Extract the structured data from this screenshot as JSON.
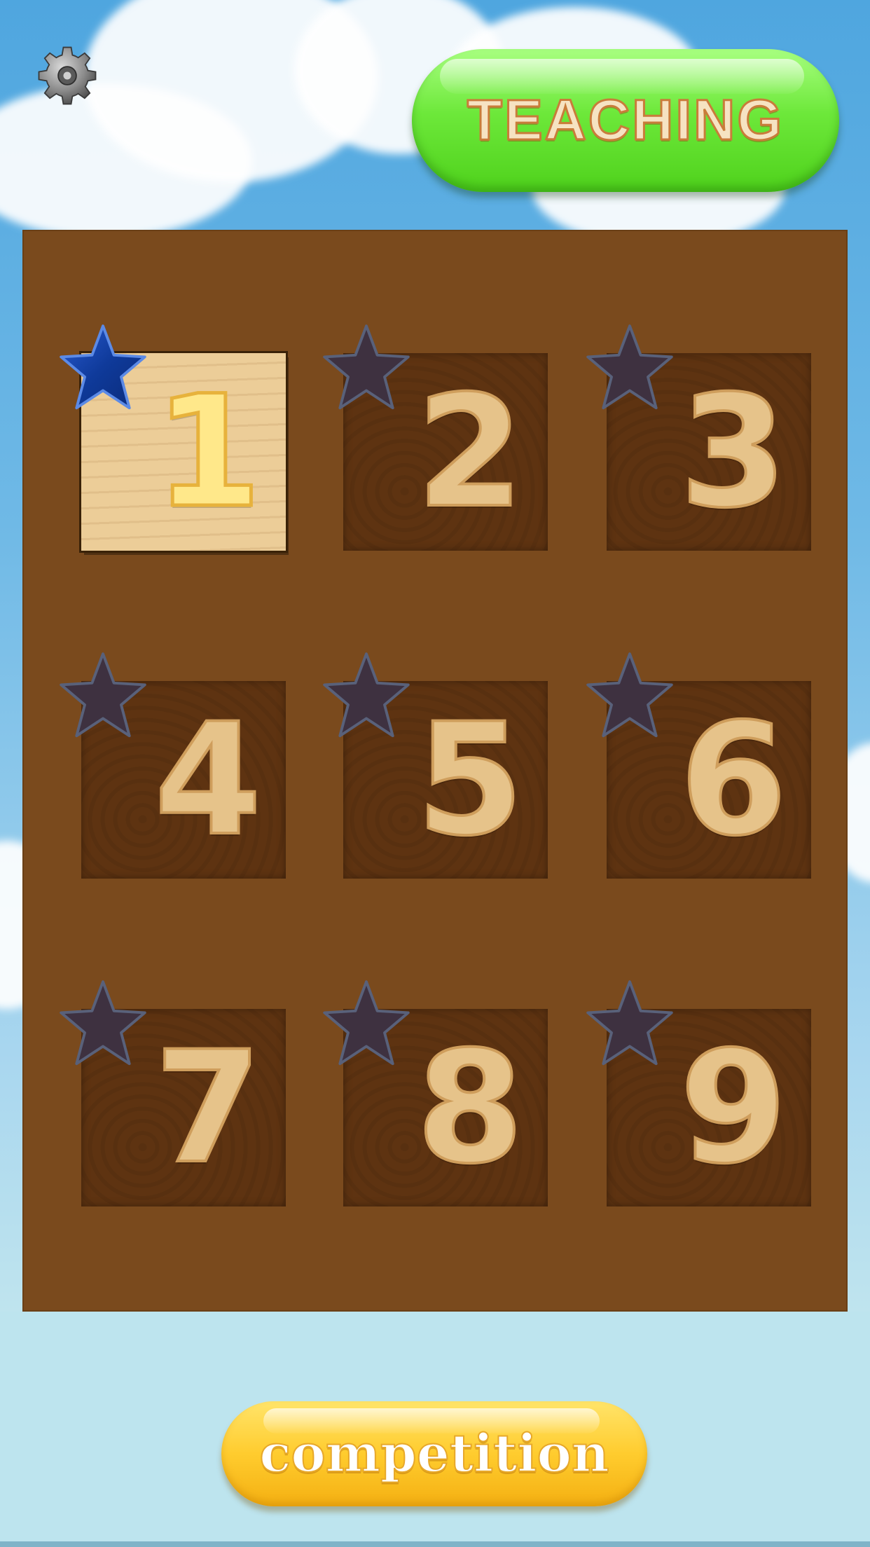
{
  "header": {
    "settings_icon": "gear-icon",
    "teaching_label": "TEACHING",
    "teaching_color": "#5ddc2a"
  },
  "board": {
    "color": "#7a4a1d",
    "tiles": [
      {
        "number": "1",
        "selected": true,
        "star": "active"
      },
      {
        "number": "2",
        "selected": false,
        "star": "inactive"
      },
      {
        "number": "3",
        "selected": false,
        "star": "inactive"
      },
      {
        "number": "4",
        "selected": false,
        "star": "inactive"
      },
      {
        "number": "5",
        "selected": false,
        "star": "inactive"
      },
      {
        "number": "6",
        "selected": false,
        "star": "inactive"
      },
      {
        "number": "7",
        "selected": false,
        "star": "inactive"
      },
      {
        "number": "8",
        "selected": false,
        "star": "inactive"
      },
      {
        "number": "9",
        "selected": false,
        "star": "inactive"
      }
    ],
    "star_icon": "star-icon",
    "star_active_color": "#123d9c",
    "star_inactive_color": "#3e3140"
  },
  "footer": {
    "competition_label": "competition",
    "competition_color": "#ffcc2e"
  }
}
